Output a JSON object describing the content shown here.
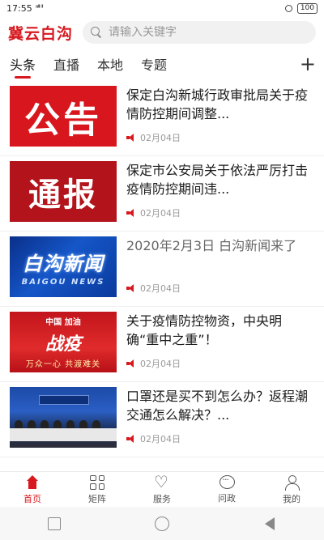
{
  "status_bar": {
    "time": "17:55",
    "signal_glyphs": "ᵃᴵˡˡ ᴵˡ",
    "battery": "100"
  },
  "header": {
    "logo": "冀云白沟",
    "search_placeholder": "请输入关键字"
  },
  "tabs": [
    {
      "label": "头条",
      "active": true
    },
    {
      "label": "直播"
    },
    {
      "label": "本地"
    },
    {
      "label": "专题"
    }
  ],
  "add_tab": "+",
  "feed": [
    {
      "title": "保定白沟新城行政审批局关于疫情防控期间调整...",
      "date": "02月04日",
      "thumb_text": "公告"
    },
    {
      "title": "保定市公安局关于依法严厉打击疫情防控期间违...",
      "date": "02月04日",
      "thumb_text": "通报"
    },
    {
      "title": "2020年2月3日 白沟新闻来了",
      "date": "02月04日",
      "thumb_text": "白沟新闻",
      "thumb_sub": "BAIGOU NEWS"
    },
    {
      "title": "关于疫情防控物资，中央明确“重中之重”！",
      "date": "02月04日",
      "thumb_top": "中国 加油",
      "thumb_mid": "战疫",
      "thumb_bottom": "万众一心 共渡难关"
    },
    {
      "title": "口罩还是买不到怎么办？返程潮交通怎么解决？...",
      "date": "02月04日"
    }
  ],
  "bottom_nav": [
    {
      "label": "首页",
      "icon": "home-icon",
      "active": true
    },
    {
      "label": "矩阵",
      "icon": "grid-icon"
    },
    {
      "label": "服务",
      "icon": "heart-icon"
    },
    {
      "label": "问政",
      "icon": "chat-icon"
    },
    {
      "label": "我的",
      "icon": "user-icon"
    }
  ],
  "colors": {
    "brand_red": "#d7191f",
    "gray_text": "#999999"
  }
}
